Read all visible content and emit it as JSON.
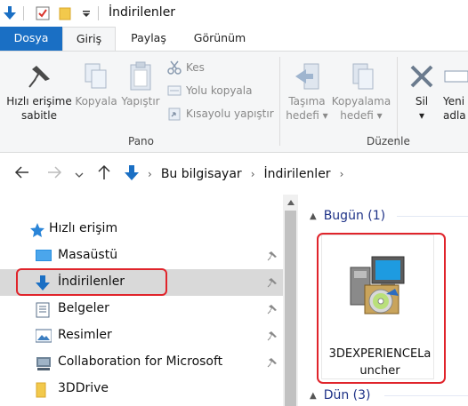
{
  "window": {
    "title": "İndirilenler"
  },
  "ribbon_tabs": {
    "file": "Dosya",
    "home": "Giriş",
    "share": "Paylaş",
    "view": "Görünüm"
  },
  "ribbon": {
    "pin_quick_access": {
      "line1": "Hızlı erişime",
      "line2": "sabitle"
    },
    "copy": "Kopyala",
    "paste": "Yapıştır",
    "cut": "Kes",
    "copy_path": "Yolu kopyala",
    "paste_shortcut": "Kısayolu yapıştır",
    "clipboard_group": "Pano",
    "move_to": {
      "line1": "Taşıma",
      "line2": "hedefi ▾"
    },
    "copy_to": {
      "line1": "Kopyalama",
      "line2": "hedefi ▾"
    },
    "delete": {
      "line1": "Sil",
      "line2": "▾"
    },
    "rename": {
      "line1": "Yeni",
      "line2": "adla"
    },
    "organize_group": "Düzenle"
  },
  "address": {
    "crumbs": [
      "Bu bilgisayar",
      "İndirilenler"
    ]
  },
  "nav_pane": {
    "quick_access": "Hızlı erişim",
    "items": [
      "Masaüstü",
      "İndirilenler",
      "Belgeler",
      "Resimler",
      "Collaboration for Microsoft",
      "3DDrive"
    ]
  },
  "content": {
    "groups": [
      {
        "label": "Bugün (1)"
      },
      {
        "label": "Dün (3)"
      }
    ],
    "files": [
      {
        "name": "3DEXPERIENCELauncher"
      }
    ]
  },
  "colors": {
    "accent": "#1a6fc4",
    "highlight_border": "#e0242b",
    "group_header": "#1e3287"
  }
}
